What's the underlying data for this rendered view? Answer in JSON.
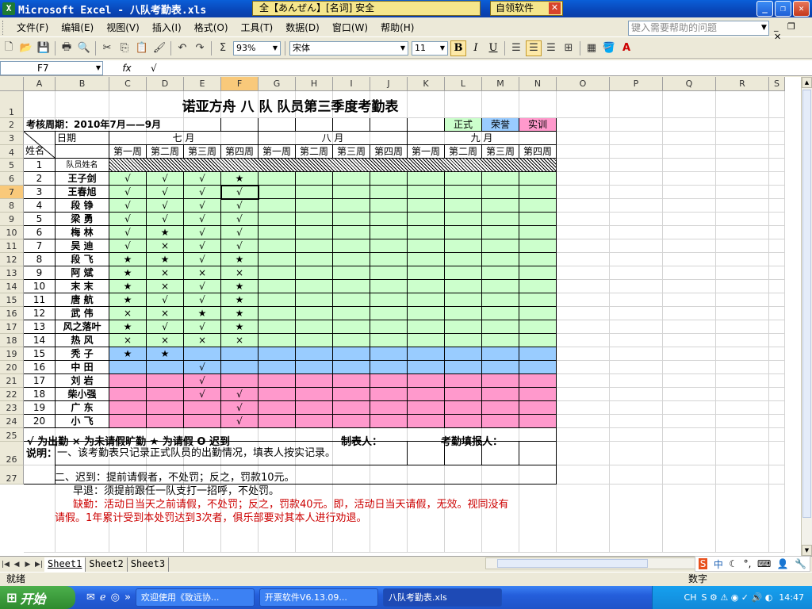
{
  "window": {
    "title": "Microsoft Excel - 八队考勤表.xls",
    "app_icon": "excel-icon",
    "ime_text": "全【あんぜん】[名词] 安全",
    "ime_soft": "自领软件"
  },
  "menu": [
    "文件(F)",
    "编辑(E)",
    "视图(V)",
    "插入(I)",
    "格式(O)",
    "工具(T)",
    "数据(D)",
    "窗口(W)",
    "帮助(H)"
  ],
  "help_placeholder": "键入需要帮助的问题",
  "toolbar": {
    "zoom": "93%",
    "font": "宋体",
    "size": "11",
    "bold": "B",
    "italic": "I",
    "underline": "U"
  },
  "formula": {
    "name_box": "F7",
    "fx": "fx",
    "content": "√"
  },
  "columns": [
    "A",
    "B",
    "C",
    "D",
    "E",
    "F",
    "G",
    "H",
    "I",
    "J",
    "K",
    "L",
    "M",
    "N",
    "O",
    "P",
    "Q",
    "R",
    "S"
  ],
  "rows": [
    "1",
    "2",
    "3",
    "4",
    "5",
    "6",
    "7",
    "8",
    "9",
    "10",
    "11",
    "12",
    "13",
    "14",
    "15",
    "16",
    "17",
    "18",
    "19",
    "20",
    "21",
    "22",
    "23",
    "24",
    "25",
    "26",
    "27"
  ],
  "sheet": {
    "title": "诺亚方舟  八 队  队员第三季度考勤表",
    "period": "考核周期：2010年7月——9月",
    "legend_tags": [
      "正式",
      "荣誉",
      "实训"
    ],
    "date_label": "日期",
    "name_label": "姓名",
    "months": [
      "七  月",
      "八  月",
      "九  月"
    ],
    "weeks": [
      "第一周",
      "第二周",
      "第三周",
      "第四周"
    ],
    "row5_label": "队员姓名",
    "members": [
      {
        "no": "1",
        "name": "",
        "marks": [
          "",
          "",
          "",
          ""
        ]
      },
      {
        "no": "2",
        "name": "王子剑",
        "marks": [
          "√",
          "√",
          "√",
          "★"
        ]
      },
      {
        "no": "3",
        "name": "王春旭",
        "marks": [
          "√",
          "√",
          "√",
          "√"
        ]
      },
      {
        "no": "4",
        "name": "段  铮",
        "marks": [
          "√",
          "√",
          "√",
          "√"
        ]
      },
      {
        "no": "5",
        "name": "梁  勇",
        "marks": [
          "√",
          "√",
          "√",
          "√"
        ]
      },
      {
        "no": "6",
        "name": "梅  林",
        "marks": [
          "√",
          "★",
          "√",
          "√"
        ]
      },
      {
        "no": "7",
        "name": "吴  迪",
        "marks": [
          "√",
          "×",
          "√",
          "√"
        ]
      },
      {
        "no": "8",
        "name": "段  飞",
        "marks": [
          "★",
          "★",
          "√",
          "★"
        ]
      },
      {
        "no": "9",
        "name": "阿  斌",
        "marks": [
          "★",
          "×",
          "×",
          "×"
        ]
      },
      {
        "no": "10",
        "name": "末  末",
        "marks": [
          "★",
          "×",
          "√",
          "★"
        ]
      },
      {
        "no": "11",
        "name": "唐  航",
        "marks": [
          "★",
          "√",
          "√",
          "★"
        ]
      },
      {
        "no": "12",
        "name": "武  伟",
        "marks": [
          "×",
          "×",
          "★",
          "★"
        ]
      },
      {
        "no": "13",
        "name": "风之落叶",
        "marks": [
          "★",
          "√",
          "√",
          "★"
        ]
      },
      {
        "no": "14",
        "name": "热  风",
        "marks": [
          "×",
          "×",
          "×",
          "×"
        ]
      },
      {
        "no": "15",
        "name": "秃  子",
        "marks": [
          "★",
          "★",
          "",
          ""
        ]
      },
      {
        "no": "16",
        "name": "中  田",
        "marks": [
          "",
          "",
          "√",
          ""
        ]
      },
      {
        "no": "17",
        "name": "刘  岩",
        "marks": [
          "",
          "",
          "√",
          ""
        ]
      },
      {
        "no": "18",
        "name": "柴小强",
        "marks": [
          "",
          "",
          "√",
          "√"
        ]
      },
      {
        "no": "19",
        "name": "广  东",
        "marks": [
          "",
          "",
          "",
          "√"
        ]
      },
      {
        "no": "20",
        "name": "小  飞",
        "marks": [
          "",
          "",
          "",
          "√"
        ]
      }
    ],
    "legend_line": "√ 为出勤  × 为未请假旷勤  ★ 为请假  O 迟到",
    "maker_label": "制表人：",
    "filler_label": "考勤填报人：",
    "note_label": "说明：",
    "note1": "一、该考勤表只记录正式队员的出勤情况，填表人按实记录。",
    "note2": "二、迟到：提前请假者，不处罚；反之，罚款10元。",
    "note3": "早退：须提前跟任一队支打一招呼，不处罚。",
    "note4": "缺勤：活动日当天之前请假，不处罚；反之，罚款40元。即，活动日当天请假，无效。视同没有",
    "note5": "请假。1年累计受到本处罚达到3次者，俱乐部要对其本人进行劝退。"
  },
  "tabs": [
    "Sheet1",
    "Sheet2",
    "Sheet3"
  ],
  "status": {
    "ready": "就绪",
    "num": "数字"
  },
  "taskbar": {
    "start": "开始",
    "tasks": [
      "欢迎使用《致远协...",
      "开票软件V6.13.09...",
      "八队考勤表.xls"
    ],
    "lang": "CH",
    "time": "14:47"
  },
  "colors": {
    "green": "#ccffcc",
    "blue": "#99ccff",
    "pink": "#ff99cc",
    "red_text": "#cc0000"
  }
}
